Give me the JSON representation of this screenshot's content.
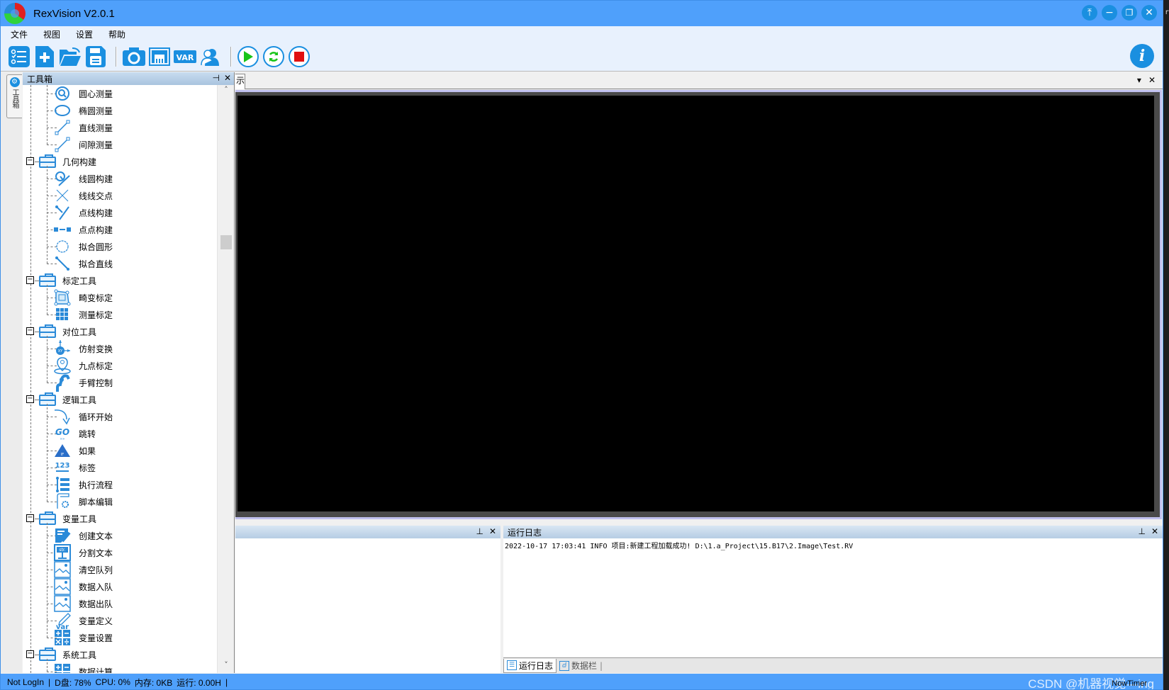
{
  "window": {
    "title": "RexVision V2.0.1",
    "controls": [
      "pin-top",
      "minimize",
      "restore",
      "close"
    ],
    "bg_right_text": "re"
  },
  "menu": [
    "文件",
    "视图",
    "设置",
    "帮助"
  ],
  "toolbar": {
    "groups": [
      [
        {
          "name": "list-icon",
          "label": "流程列表"
        },
        {
          "name": "new-file-icon",
          "label": "新建"
        },
        {
          "name": "open-folder-icon",
          "label": "打开"
        },
        {
          "name": "save-icon",
          "label": "保存"
        }
      ],
      [
        {
          "name": "camera-icon",
          "label": "相机"
        },
        {
          "name": "image-source-icon",
          "label": "图像"
        },
        {
          "name": "var-icon",
          "label": "VAR"
        },
        {
          "name": "user-icon",
          "label": "用户"
        }
      ],
      [
        {
          "name": "run-icon",
          "label": "运行"
        },
        {
          "name": "loop-icon",
          "label": "循环"
        },
        {
          "name": "stop-icon",
          "label": "停止"
        }
      ]
    ],
    "var_text": "VAR",
    "info_text": "i"
  },
  "side_strip": {
    "tab_label": "工具箱"
  },
  "toolbox": {
    "title": "工具箱",
    "categories": [
      {
        "label": null,
        "items": [
          {
            "label": "圆心测量",
            "icon": "circle-measure-icon"
          },
          {
            "label": "椭圆测量",
            "icon": "ellipse-measure-icon"
          },
          {
            "label": "直线测量",
            "icon": "line-measure-icon"
          },
          {
            "label": "间隙测量",
            "icon": "gap-measure-icon"
          }
        ]
      },
      {
        "label": "几何构建",
        "items": [
          {
            "label": "线圆构建",
            "icon": "line-circle-icon"
          },
          {
            "label": "线线交点",
            "icon": "intersection-icon"
          },
          {
            "label": "点线构建",
            "icon": "point-line-icon"
          },
          {
            "label": "点点构建",
            "icon": "point-point-icon"
          },
          {
            "label": "拟合圆形",
            "icon": "fit-circle-icon"
          },
          {
            "label": "拟合直线",
            "icon": "fit-line-icon"
          }
        ]
      },
      {
        "label": "标定工具",
        "items": [
          {
            "label": "畸变标定",
            "icon": "distortion-calib-icon"
          },
          {
            "label": "测量标定",
            "icon": "grid-calib-icon"
          }
        ]
      },
      {
        "label": "对位工具",
        "items": [
          {
            "label": "仿射变换",
            "icon": "affine-xy-icon"
          },
          {
            "label": "九点标定",
            "icon": "location-pin-icon"
          },
          {
            "label": "手臂控制",
            "icon": "robot-arm-icon"
          }
        ]
      },
      {
        "label": "逻辑工具",
        "items": [
          {
            "label": "循环开始",
            "icon": "loop-arrow-icon"
          },
          {
            "label": "跳转",
            "icon": "go-icon"
          },
          {
            "label": "如果",
            "icon": "if-triangle-icon"
          },
          {
            "label": "标签",
            "icon": "number-label-icon"
          },
          {
            "label": "执行流程",
            "icon": "flow-list-icon"
          },
          {
            "label": "脚本编辑",
            "icon": "script-gear-icon"
          }
        ]
      },
      {
        "label": "变量工具",
        "items": [
          {
            "label": "创建文本",
            "icon": "edit-text-icon"
          },
          {
            "label": "分割文本",
            "icon": "split-str-icon"
          },
          {
            "label": "清空队列",
            "icon": "image-queue-icon"
          },
          {
            "label": "数据入队",
            "icon": "image-queue-icon"
          },
          {
            "label": "数据出队",
            "icon": "image-queue-icon"
          },
          {
            "label": "变量定义",
            "icon": "var-pencil-icon"
          },
          {
            "label": "变量设置",
            "icon": "calculator-icon"
          }
        ]
      },
      {
        "label": "系统工具",
        "items": [
          {
            "label": "数据计算",
            "icon": "calculator-icon"
          }
        ]
      }
    ]
  },
  "document": {
    "tab_label": "示",
    "canvas_color": "#000000"
  },
  "bottom_left_panel": {
    "title": ""
  },
  "log_panel": {
    "title": "运行日志",
    "entries": [
      "2022-10-17 17:03:41 INFO  项目:新建工程加载成功! D:\\1.a_Project\\15.B17\\2.Image\\Test.RV"
    ],
    "tabs": [
      {
        "label": "运行日志",
        "active": true
      },
      {
        "label": "数据栏",
        "active": false
      }
    ]
  },
  "statusbar": {
    "login": "Not LogIn",
    "disk": "D盘: 78%",
    "cpu": "CPU: 0%",
    "memory": "内存: 0KB",
    "runtime": "运行: 0.00H",
    "timer": "NowTimer",
    "watermark": "CSDN @机器视觉—ing"
  },
  "colors": {
    "title_bar": "#4fa0fb",
    "accent": "#1a8fe0",
    "run_green": "#18c418",
    "stop_red": "#e01010"
  }
}
